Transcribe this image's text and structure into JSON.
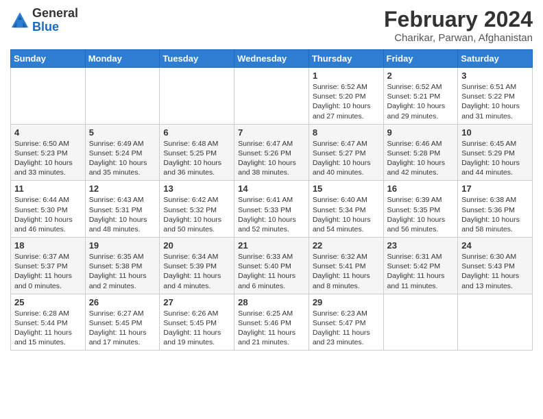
{
  "header": {
    "logo_general": "General",
    "logo_blue": "Blue",
    "title": "February 2024",
    "location": "Charikar, Parwan, Afghanistan"
  },
  "days_of_week": [
    "Sunday",
    "Monday",
    "Tuesday",
    "Wednesday",
    "Thursday",
    "Friday",
    "Saturday"
  ],
  "weeks": [
    [
      {
        "day": "",
        "info": ""
      },
      {
        "day": "",
        "info": ""
      },
      {
        "day": "",
        "info": ""
      },
      {
        "day": "",
        "info": ""
      },
      {
        "day": "1",
        "info": "Sunrise: 6:52 AM\nSunset: 5:20 PM\nDaylight: 10 hours and 27 minutes."
      },
      {
        "day": "2",
        "info": "Sunrise: 6:52 AM\nSunset: 5:21 PM\nDaylight: 10 hours and 29 minutes."
      },
      {
        "day": "3",
        "info": "Sunrise: 6:51 AM\nSunset: 5:22 PM\nDaylight: 10 hours and 31 minutes."
      }
    ],
    [
      {
        "day": "4",
        "info": "Sunrise: 6:50 AM\nSunset: 5:23 PM\nDaylight: 10 hours and 33 minutes."
      },
      {
        "day": "5",
        "info": "Sunrise: 6:49 AM\nSunset: 5:24 PM\nDaylight: 10 hours and 35 minutes."
      },
      {
        "day": "6",
        "info": "Sunrise: 6:48 AM\nSunset: 5:25 PM\nDaylight: 10 hours and 36 minutes."
      },
      {
        "day": "7",
        "info": "Sunrise: 6:47 AM\nSunset: 5:26 PM\nDaylight: 10 hours and 38 minutes."
      },
      {
        "day": "8",
        "info": "Sunrise: 6:47 AM\nSunset: 5:27 PM\nDaylight: 10 hours and 40 minutes."
      },
      {
        "day": "9",
        "info": "Sunrise: 6:46 AM\nSunset: 5:28 PM\nDaylight: 10 hours and 42 minutes."
      },
      {
        "day": "10",
        "info": "Sunrise: 6:45 AM\nSunset: 5:29 PM\nDaylight: 10 hours and 44 minutes."
      }
    ],
    [
      {
        "day": "11",
        "info": "Sunrise: 6:44 AM\nSunset: 5:30 PM\nDaylight: 10 hours and 46 minutes."
      },
      {
        "day": "12",
        "info": "Sunrise: 6:43 AM\nSunset: 5:31 PM\nDaylight: 10 hours and 48 minutes."
      },
      {
        "day": "13",
        "info": "Sunrise: 6:42 AM\nSunset: 5:32 PM\nDaylight: 10 hours and 50 minutes."
      },
      {
        "day": "14",
        "info": "Sunrise: 6:41 AM\nSunset: 5:33 PM\nDaylight: 10 hours and 52 minutes."
      },
      {
        "day": "15",
        "info": "Sunrise: 6:40 AM\nSunset: 5:34 PM\nDaylight: 10 hours and 54 minutes."
      },
      {
        "day": "16",
        "info": "Sunrise: 6:39 AM\nSunset: 5:35 PM\nDaylight: 10 hours and 56 minutes."
      },
      {
        "day": "17",
        "info": "Sunrise: 6:38 AM\nSunset: 5:36 PM\nDaylight: 10 hours and 58 minutes."
      }
    ],
    [
      {
        "day": "18",
        "info": "Sunrise: 6:37 AM\nSunset: 5:37 PM\nDaylight: 11 hours and 0 minutes."
      },
      {
        "day": "19",
        "info": "Sunrise: 6:35 AM\nSunset: 5:38 PM\nDaylight: 11 hours and 2 minutes."
      },
      {
        "day": "20",
        "info": "Sunrise: 6:34 AM\nSunset: 5:39 PM\nDaylight: 11 hours and 4 minutes."
      },
      {
        "day": "21",
        "info": "Sunrise: 6:33 AM\nSunset: 5:40 PM\nDaylight: 11 hours and 6 minutes."
      },
      {
        "day": "22",
        "info": "Sunrise: 6:32 AM\nSunset: 5:41 PM\nDaylight: 11 hours and 8 minutes."
      },
      {
        "day": "23",
        "info": "Sunrise: 6:31 AM\nSunset: 5:42 PM\nDaylight: 11 hours and 11 minutes."
      },
      {
        "day": "24",
        "info": "Sunrise: 6:30 AM\nSunset: 5:43 PM\nDaylight: 11 hours and 13 minutes."
      }
    ],
    [
      {
        "day": "25",
        "info": "Sunrise: 6:28 AM\nSunset: 5:44 PM\nDaylight: 11 hours and 15 minutes."
      },
      {
        "day": "26",
        "info": "Sunrise: 6:27 AM\nSunset: 5:45 PM\nDaylight: 11 hours and 17 minutes."
      },
      {
        "day": "27",
        "info": "Sunrise: 6:26 AM\nSunset: 5:45 PM\nDaylight: 11 hours and 19 minutes."
      },
      {
        "day": "28",
        "info": "Sunrise: 6:25 AM\nSunset: 5:46 PM\nDaylight: 11 hours and 21 minutes."
      },
      {
        "day": "29",
        "info": "Sunrise: 6:23 AM\nSunset: 5:47 PM\nDaylight: 11 hours and 23 minutes."
      },
      {
        "day": "",
        "info": ""
      },
      {
        "day": "",
        "info": ""
      }
    ]
  ]
}
